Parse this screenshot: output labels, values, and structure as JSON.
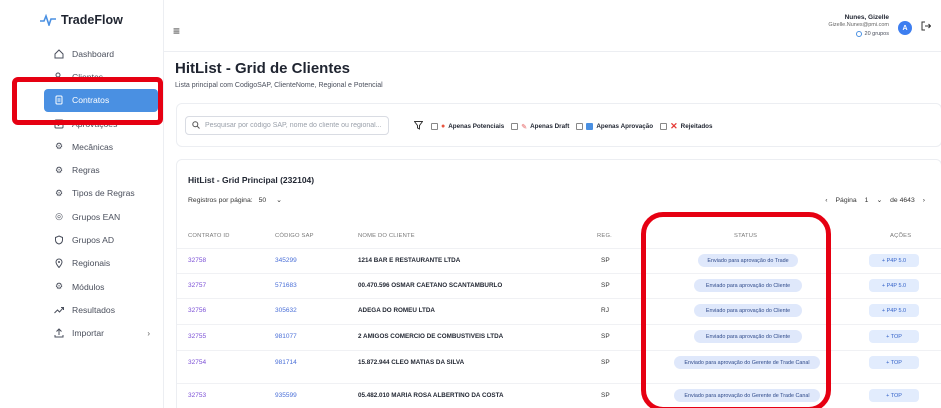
{
  "app": {
    "name": "TradeFlow"
  },
  "sidebar": {
    "items": [
      {
        "label": "Dashboard",
        "icon": "home-icon"
      },
      {
        "label": "Clientes",
        "icon": "users-icon"
      },
      {
        "label": "Contratos",
        "icon": "document-icon",
        "active": true
      },
      {
        "label": "Aprovações",
        "icon": "check-square-icon"
      },
      {
        "label": "Mecânicas",
        "icon": "gear-icon"
      },
      {
        "label": "Regras",
        "icon": "gear-icon"
      },
      {
        "label": "Tipos de Regras",
        "icon": "gear-icon"
      },
      {
        "label": "Grupos EAN",
        "icon": "target-icon"
      },
      {
        "label": "Grupos AD",
        "icon": "shield-icon"
      },
      {
        "label": "Regionais",
        "icon": "location-icon"
      },
      {
        "label": "Módulos",
        "icon": "gear-icon"
      },
      {
        "label": "Resultados",
        "icon": "trend-icon"
      },
      {
        "label": "Importar",
        "icon": "upload-icon",
        "has_children": true
      }
    ]
  },
  "topbar": {
    "user_name": "Nunes, Gizelle",
    "user_email": "Gizelle.Nunes@pmi.com",
    "groups": "20 grupos",
    "avatar_letter": "A"
  },
  "page": {
    "title": "HitList - Grid de Clientes",
    "subtitle": "Lista principal com CodigoSAP, ClienteNome, Regional e Potencial"
  },
  "filters": {
    "search_placeholder": "Pesquisar por código SAP, nome do cliente ou regional...",
    "options": [
      {
        "label": "Apenas Potenciais",
        "color": "#e8553f"
      },
      {
        "label": "Apenas Draft",
        "color": "#f0a5a5"
      },
      {
        "label": "Apenas Aprovação",
        "color": "#4a90e2"
      },
      {
        "label": "Rejeitados",
        "color": "#e53935"
      }
    ]
  },
  "grid": {
    "title": "HitList - Grid Principal (232104)",
    "per_page_label": "Registros por página:",
    "per_page_value": "50",
    "page_label": "Página",
    "page_value": "1",
    "page_total": "de 4643",
    "columns": [
      "CONTRATO ID",
      "CÓDIGO SAP",
      "NOME DO CLIENTE",
      "REG.",
      "STATUS",
      "AÇÕES"
    ],
    "rows": [
      {
        "id": "32758",
        "sap": "345299",
        "name": "1214 BAR E RESTAURANTE LTDA",
        "reg": "SP",
        "status": "Enviado para aprovação do Trade",
        "action": "+ P4P 5.0"
      },
      {
        "id": "32757",
        "sap": "571683",
        "name": "00.470.596 OSMAR CAETANO SCANTAMBURLO",
        "reg": "SP",
        "status": "Enviado para aprovação do Cliente",
        "action": "+ P4P 5.0"
      },
      {
        "id": "32756",
        "sap": "305632",
        "name": "ADEGA DO ROMEU LTDA",
        "reg": "RJ",
        "status": "Enviado para aprovação do Cliente",
        "action": "+ P4P 5.0"
      },
      {
        "id": "32755",
        "sap": "981077",
        "name": "2 AMIGOS COMERCIO DE COMBUSTIVEIS LTDA",
        "reg": "SP",
        "status": "Enviado para aprovação do Cliente",
        "action": "+ TOP"
      },
      {
        "id": "32754",
        "sap": "981714",
        "name": "15.872.944 CLEO MATIAS DA SILVA",
        "reg": "SP",
        "status": "Enviado para aprovação do Gerente de Trade Canal",
        "action": "+ TOP"
      },
      {
        "id": "32753",
        "sap": "935599",
        "name": "05.482.010 MARIA ROSA ALBERTINO DA COSTA",
        "reg": "SP",
        "status": "Enviado para aprovação do Gerente de Trade Canal",
        "action": "+ TOP"
      }
    ]
  }
}
